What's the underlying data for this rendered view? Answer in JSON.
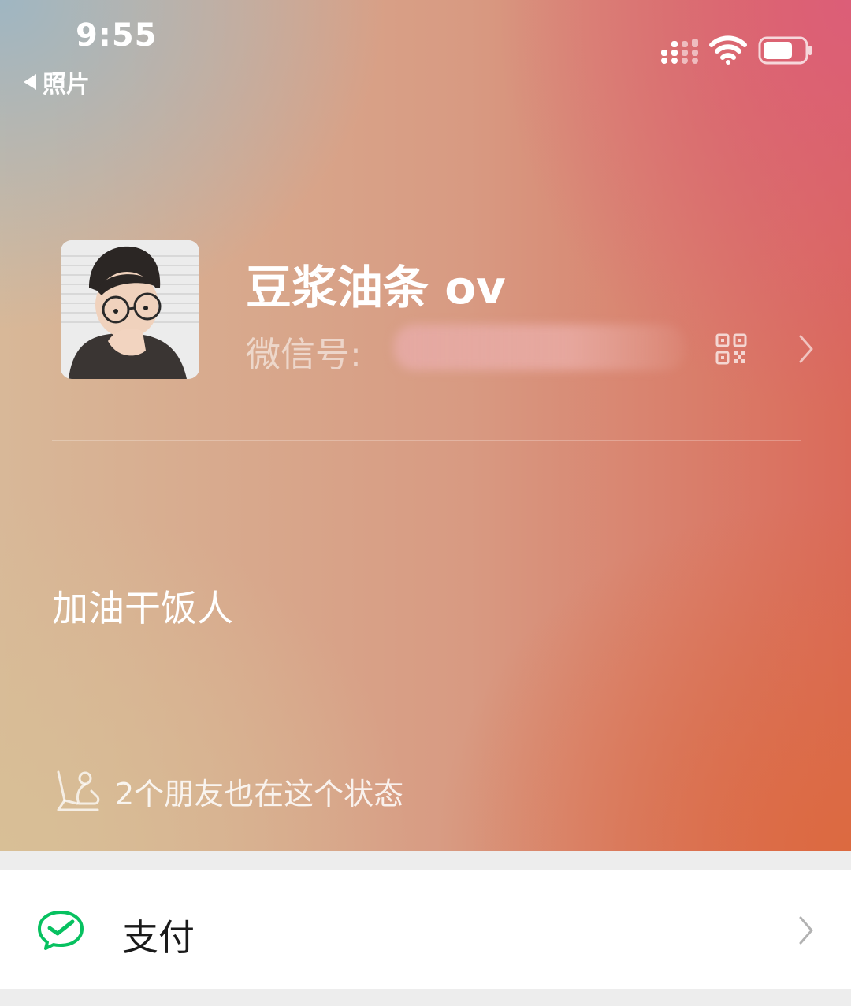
{
  "status_bar": {
    "time": "9:55",
    "back_label": "照片",
    "icons": [
      "signal-icon",
      "wifi-icon",
      "battery-icon"
    ]
  },
  "profile": {
    "name": "豆浆油条 ov",
    "wechat_id_label": "微信号:",
    "icons": [
      "qr-code-icon",
      "chevron-right-icon"
    ]
  },
  "status": {
    "text": "加油干饭人",
    "friends_text": "2个朋友也在这个状态",
    "icon": "person-lounging-icon"
  },
  "menu": {
    "items": [
      {
        "label": "支付",
        "icon": "wechat-pay-icon"
      }
    ]
  },
  "colors": {
    "pay_green": "#07c160",
    "divider": "#ededed"
  }
}
